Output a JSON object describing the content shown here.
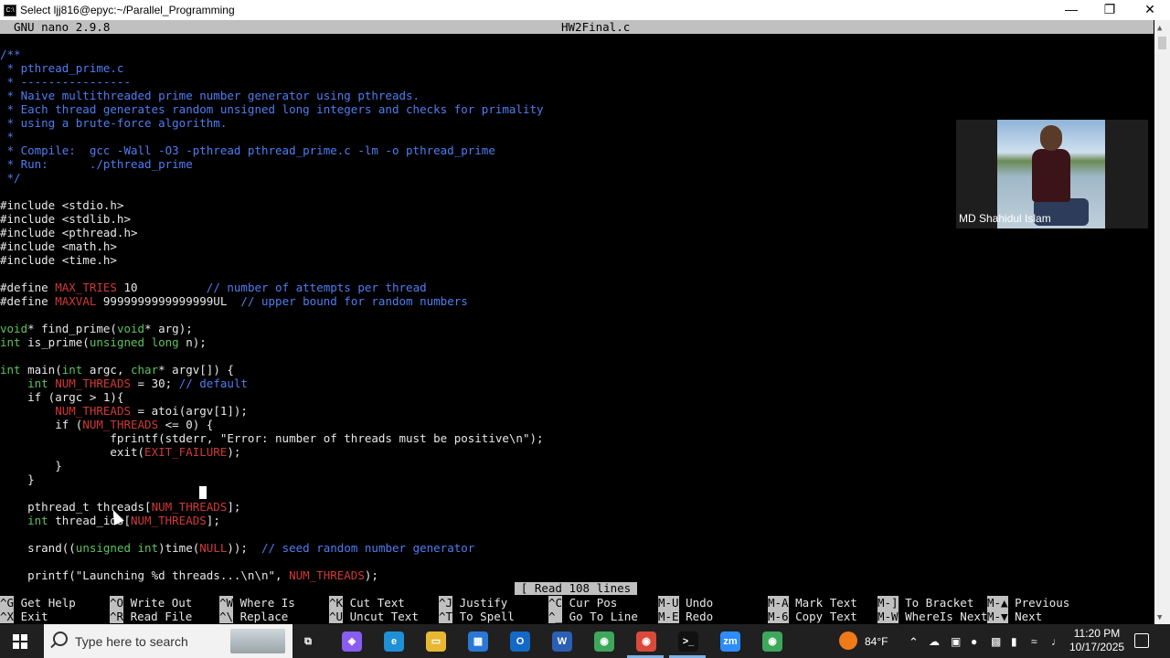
{
  "window": {
    "title": "Select ljj816@epyc:~/Parallel_Programming",
    "app_icon_label": "C:\\",
    "minimize_icon": "minimize-icon",
    "restore_icon": "restore-icon",
    "close_icon": "close-icon"
  },
  "nano": {
    "version": "GNU nano 2.9.8",
    "filename": "HW2Final.c",
    "status": "[ Read 108 lines ]"
  },
  "code_lines": [
    [
      {
        "t": "/**",
        "c": "c"
      }
    ],
    [
      {
        "t": " * pthread_prime.c",
        "c": "c"
      }
    ],
    [
      {
        "t": " * ----------------",
        "c": "c"
      }
    ],
    [
      {
        "t": " * Naive multithreaded prime number generator using pthreads.",
        "c": "c"
      }
    ],
    [
      {
        "t": " * Each thread generates random unsigned long integers and checks for primality",
        "c": "c"
      }
    ],
    [
      {
        "t": " * using a brute-force algorithm.",
        "c": "c"
      }
    ],
    [
      {
        "t": " *",
        "c": "c"
      }
    ],
    [
      {
        "t": " * Compile:  gcc -Wall -O3 -pthread pthread_prime.c -lm -o pthread_prime",
        "c": "c"
      }
    ],
    [
      {
        "t": " * Run:      ./pthread_prime",
        "c": "c"
      }
    ],
    [
      {
        "t": " */",
        "c": "c"
      }
    ],
    [
      {
        "t": "",
        "c": ""
      }
    ],
    [
      {
        "t": "#include <stdio.h>",
        "c": ""
      }
    ],
    [
      {
        "t": "#include <stdlib.h>",
        "c": ""
      }
    ],
    [
      {
        "t": "#include <pthread.h>",
        "c": ""
      }
    ],
    [
      {
        "t": "#include <math.h>",
        "c": ""
      }
    ],
    [
      {
        "t": "#include <time.h>",
        "c": ""
      }
    ],
    [
      {
        "t": "",
        "c": ""
      }
    ],
    [
      {
        "t": "#define ",
        "c": ""
      },
      {
        "t": "MAX_TRIES",
        "c": "r"
      },
      {
        "t": " 10          ",
        "c": ""
      },
      {
        "t": "// number of attempts per thread",
        "c": "c"
      }
    ],
    [
      {
        "t": "#define ",
        "c": ""
      },
      {
        "t": "MAXVAL",
        "c": "r"
      },
      {
        "t": " 9999999999999999UL  ",
        "c": ""
      },
      {
        "t": "// upper bound for random numbers",
        "c": "c"
      }
    ],
    [
      {
        "t": "",
        "c": ""
      }
    ],
    [
      {
        "t": "void",
        "c": "p"
      },
      {
        "t": "* find_prime(",
        "c": ""
      },
      {
        "t": "void",
        "c": "p"
      },
      {
        "t": "* arg);",
        "c": ""
      }
    ],
    [
      {
        "t": "int",
        "c": "p"
      },
      {
        "t": " is_prime(",
        "c": ""
      },
      {
        "t": "unsigned long",
        "c": "p"
      },
      {
        "t": " n);",
        "c": ""
      }
    ],
    [
      {
        "t": "",
        "c": ""
      }
    ],
    [
      {
        "t": "int",
        "c": "p"
      },
      {
        "t": " main(",
        "c": ""
      },
      {
        "t": "int",
        "c": "p"
      },
      {
        "t": " argc, ",
        "c": ""
      },
      {
        "t": "char",
        "c": "p"
      },
      {
        "t": "* argv[]) {",
        "c": ""
      }
    ],
    [
      {
        "t": "    ",
        "c": ""
      },
      {
        "t": "int",
        "c": "p"
      },
      {
        "t": " ",
        "c": ""
      },
      {
        "t": "NUM_THREADS",
        "c": "r"
      },
      {
        "t": " = 30; ",
        "c": ""
      },
      {
        "t": "// default",
        "c": "c"
      }
    ],
    [
      {
        "t": "    if (argc > 1){",
        "c": ""
      }
    ],
    [
      {
        "t": "        ",
        "c": ""
      },
      {
        "t": "NUM_THREADS",
        "c": "r"
      },
      {
        "t": " = atoi(argv[1]);",
        "c": ""
      }
    ],
    [
      {
        "t": "        if (",
        "c": ""
      },
      {
        "t": "NUM_THREADS",
        "c": "r"
      },
      {
        "t": " <= 0) {",
        "c": ""
      }
    ],
    [
      {
        "t": "                fprintf(stderr, \"Error: number of threads must be positive\\n\");",
        "c": ""
      }
    ],
    [
      {
        "t": "                exit(",
        "c": ""
      },
      {
        "t": "EXIT_FAILURE",
        "c": "r"
      },
      {
        "t": ");",
        "c": ""
      }
    ],
    [
      {
        "t": "        }",
        "c": ""
      }
    ],
    [
      {
        "t": "    }",
        "c": ""
      }
    ],
    [
      {
        "t": "",
        "c": ""
      }
    ],
    [
      {
        "t": "    pthread_t threads[",
        "c": ""
      },
      {
        "t": "NUM_THREADS",
        "c": "r"
      },
      {
        "t": "];",
        "c": ""
      }
    ],
    [
      {
        "t": "    ",
        "c": ""
      },
      {
        "t": "int",
        "c": "p"
      },
      {
        "t": " thread_ids[",
        "c": ""
      },
      {
        "t": "NUM_THREADS",
        "c": "r"
      },
      {
        "t": "];",
        "c": ""
      }
    ],
    [
      {
        "t": "",
        "c": ""
      }
    ],
    [
      {
        "t": "    srand((",
        "c": ""
      },
      {
        "t": "unsigned int",
        "c": "p"
      },
      {
        "t": ")time(",
        "c": ""
      },
      {
        "t": "NULL",
        "c": "r"
      },
      {
        "t": "));  ",
        "c": ""
      },
      {
        "t": "// seed random number generator",
        "c": "c"
      }
    ],
    [
      {
        "t": "",
        "c": ""
      }
    ],
    [
      {
        "t": "    printf(\"Launching %d threads...\\n\\n\", ",
        "c": ""
      },
      {
        "t": "NUM_THREADS",
        "c": "r"
      },
      {
        "t": ");",
        "c": ""
      }
    ]
  ],
  "shortcuts": {
    "row1": [
      {
        "key": "^G",
        "label": "Get Help"
      },
      {
        "key": "^O",
        "label": "Write Out"
      },
      {
        "key": "^W",
        "label": "Where Is"
      },
      {
        "key": "^K",
        "label": "Cut Text"
      },
      {
        "key": "^J",
        "label": "Justify"
      },
      {
        "key": "^C",
        "label": "Cur Pos"
      },
      {
        "key": "M-U",
        "label": "Undo"
      },
      {
        "key": "M-A",
        "label": "Mark Text"
      },
      {
        "key": "M-]",
        "label": "To Bracket"
      },
      {
        "key": "M-▲",
        "label": "Previous"
      }
    ],
    "row2": [
      {
        "key": "^X",
        "label": "Exit"
      },
      {
        "key": "^R",
        "label": "Read File"
      },
      {
        "key": "^\\",
        "label": "Replace"
      },
      {
        "key": "^U",
        "label": "Uncut Text"
      },
      {
        "key": "^T",
        "label": "To Spell"
      },
      {
        "key": "^_",
        "label": "Go To Line"
      },
      {
        "key": "M-E",
        "label": "Redo"
      },
      {
        "key": "M-6",
        "label": "Copy Text"
      },
      {
        "key": "M-W",
        "label": "WhereIs Next"
      },
      {
        "key": "M-▼",
        "label": "Next"
      }
    ]
  },
  "video": {
    "participant_name": "MD Shahidul Islam"
  },
  "taskbar": {
    "search_placeholder": "Type here to search",
    "icons": [
      {
        "name": "task-view-icon",
        "glyph": "⧉",
        "color": "#202020"
      },
      {
        "name": "copilot-icon",
        "glyph": "◈",
        "color": "#8a5cf0"
      },
      {
        "name": "edge-icon",
        "glyph": "e",
        "color": "#1f8fd6"
      },
      {
        "name": "file-explorer-icon",
        "glyph": "▭",
        "color": "#e8b832"
      },
      {
        "name": "microsoft-store-icon",
        "glyph": "▦",
        "color": "#2a78d6"
      },
      {
        "name": "outlook-icon",
        "glyph": "O",
        "color": "#1469c7"
      },
      {
        "name": "word-icon",
        "glyph": "W",
        "color": "#2b5fb3"
      },
      {
        "name": "chrome-icon",
        "glyph": "◉",
        "color": "#3da75a"
      },
      {
        "name": "chrome-profile-icon",
        "glyph": "◉",
        "color": "#d94a3b"
      },
      {
        "name": "terminal-icon",
        "glyph": ">_",
        "color": "#111111"
      },
      {
        "name": "zoom-icon",
        "glyph": "zm",
        "color": "#2d8cff"
      },
      {
        "name": "chrome-alt-icon",
        "glyph": "◉",
        "color": "#3da75a"
      }
    ],
    "weather": "84°F",
    "time": "11:20 PM",
    "date": "10/17/2025"
  }
}
